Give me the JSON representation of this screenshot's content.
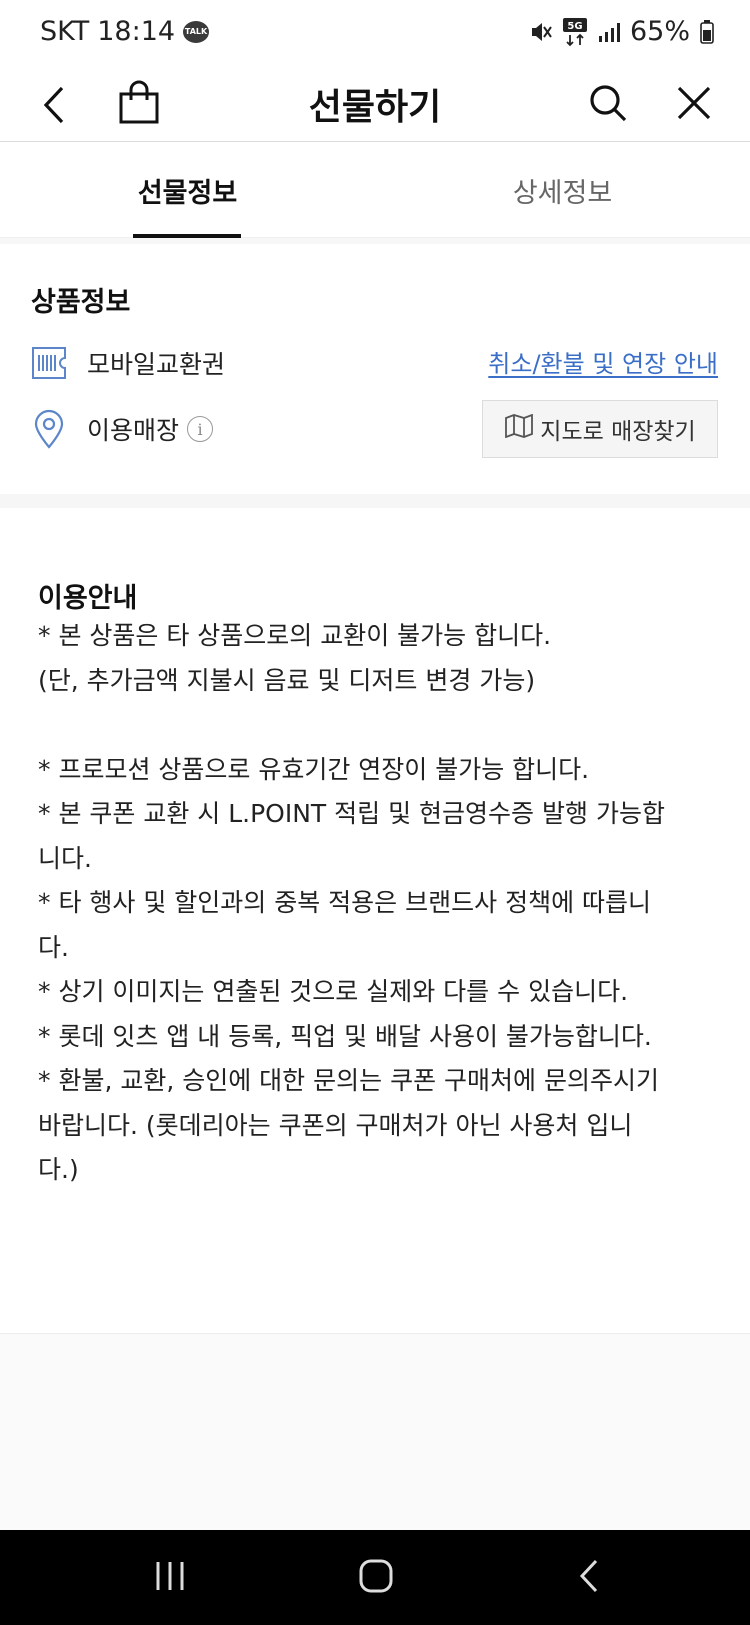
{
  "status_bar": {
    "carrier": "SKT",
    "time": "18:14",
    "talk_badge": "TALK",
    "network": "5G",
    "battery": "65%"
  },
  "header": {
    "title": "선물하기",
    "icons": [
      "back-icon",
      "shopping-bag-icon",
      "search-icon",
      "close-icon"
    ]
  },
  "tabs": [
    {
      "label": "선물정보",
      "active": true
    },
    {
      "label": "상세정보",
      "active": false
    }
  ],
  "product_info": {
    "heading": "상품정보",
    "voucher_label": "모바일교환권",
    "refund_link": "취소/환불 및 연장 안내",
    "store_label": "이용매장",
    "info_icon": "i",
    "map_button": "지도로 매장찾기"
  },
  "usage_guide": {
    "title": "이용안내",
    "lines": [
      "* 본 상품은 타 상품으로의 교환이 불가능 합니다.",
      "(단, 추가금액 지불시 음료 및 디저트 변경 가능)",
      "",
      "* 프로모션 상품으로 유효기간 연장이 불가능 합니다.",
      "* 본 쿠폰 교환 시 L.POINT 적립 및 현금영수증 발행 가능합",
      "니다.",
      "* 타 행사 및 할인과의 중복 적용은 브랜드사 정책에 따릅니",
      "다.",
      "* 상기 이미지는 연출된 것으로 실제와 다를 수 있습니다.",
      "* 롯데 잇츠 앱 내 등록, 픽업 및 배달 사용이 불가능합니다.",
      "* 환불, 교환, 승인에 대한 문의는 쿠폰 구매처에 문의주시기",
      "바랍니다. (롯데리아는 쿠폰의 구매처가 아닌 사용처 입니",
      "다.)"
    ]
  },
  "colors": {
    "link": "#3b6fc7",
    "icon_blue": "#5b86c9",
    "nav_bar": "#000000"
  }
}
